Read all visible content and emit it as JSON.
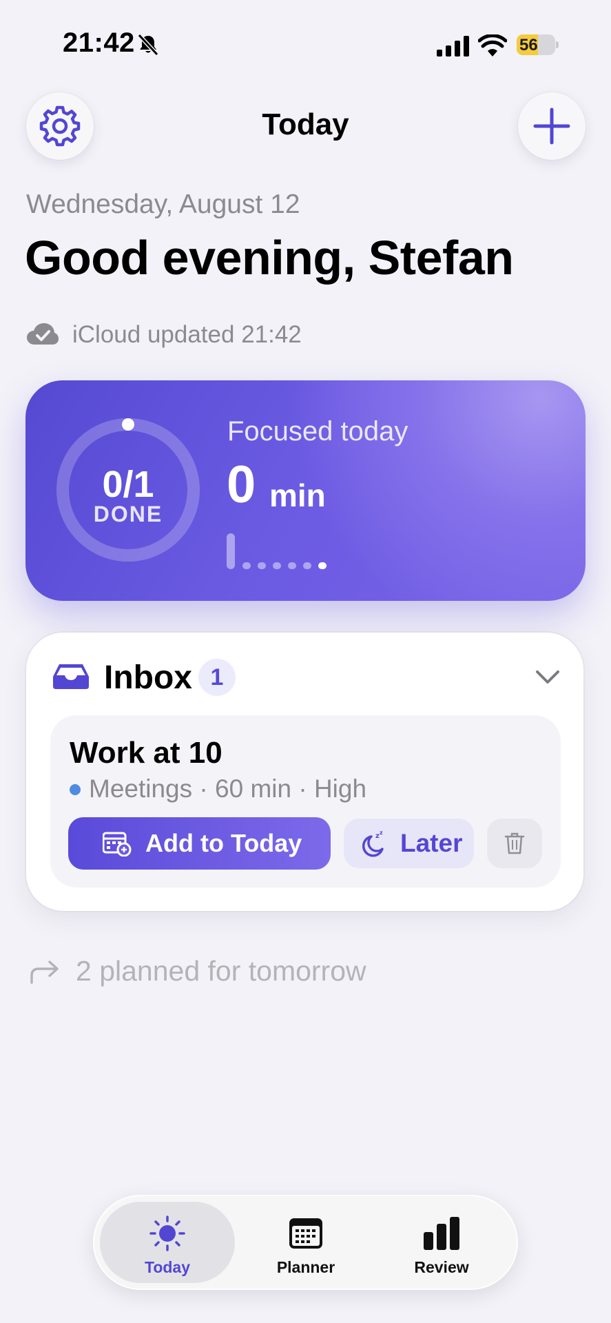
{
  "status_bar": {
    "time": "21:42",
    "battery": "56",
    "battery_level": 0.56
  },
  "header": {
    "title": "Today"
  },
  "greeting": {
    "date": "Wednesday, August 12",
    "text": "Good evening, Stefan",
    "sync_status": "iCloud updated 21:42"
  },
  "focus": {
    "done": "0/1",
    "done_label": "DONE",
    "progress": 0,
    "label": "Focused today",
    "value": "0",
    "unit": "min"
  },
  "inbox": {
    "title": "Inbox",
    "count": "1",
    "task": {
      "title": "Work at 10",
      "meta": "Meetings · 60 min · High",
      "add_label": "Add to Today",
      "later_label": "Later"
    }
  },
  "tomorrow": {
    "text": "2 planned for tomorrow"
  },
  "tabs": [
    {
      "label": "Today",
      "active": true
    },
    {
      "label": "Planner",
      "active": false
    },
    {
      "label": "Review",
      "active": false
    }
  ],
  "colors": {
    "accent": "#5649d6",
    "background": "#f3f2f8",
    "card_gradient_start": "#5549d2",
    "card_gradient_end": "#7865e8"
  }
}
